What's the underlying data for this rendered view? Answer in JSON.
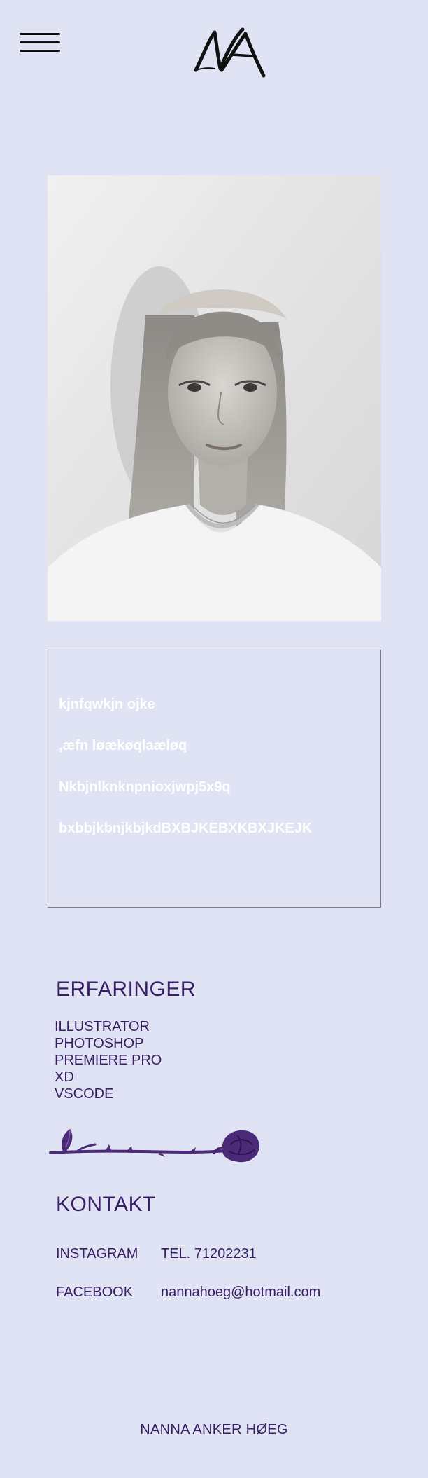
{
  "header": {
    "menu_icon": "hamburger-menu-icon",
    "logo": "na-monogram-logo"
  },
  "profile": {
    "image": "grayscale-portrait-photo"
  },
  "intro_box": {
    "lines": [
      "kjnfqwkjn  ojke",
      ",æfn løækøqlaæløq",
      "Nkbjnlknknpnioxjwpj5x9q",
      "bxbbjkbnjkbjkdBXBJKEBXKBXJKEJK"
    ]
  },
  "experience": {
    "title": "ERFARINGER",
    "skills": [
      "ILLUSTRATOR",
      "PHOTOSHOP",
      "PREMIERE PRO",
      "XD",
      "VSCODE"
    ]
  },
  "divider": {
    "image": "purple-rose-illustration"
  },
  "contact": {
    "title": "KONTAKT",
    "instagram": "INSTAGRAM",
    "phone": "TEL. 71202231",
    "facebook": "FACEBOOK",
    "email": "nannahoeg@hotmail.com"
  },
  "footer": {
    "name": "NANNA ANKER HØEG"
  },
  "colors": {
    "background": "#dfe3f3",
    "text": "#3a1f66",
    "box_text": "#ffffff",
    "rose": "#4b2a78"
  }
}
